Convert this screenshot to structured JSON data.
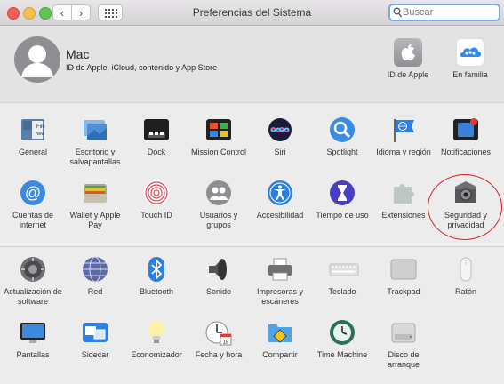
{
  "window": {
    "title": "Preferencias del Sistema"
  },
  "search": {
    "placeholder": "Buscar"
  },
  "account": {
    "name": "Mac",
    "subtitle": "ID de Apple, iCloud, contenido y App Store"
  },
  "account_items": [
    {
      "label": "ID de Apple",
      "icon": "apple-id-icon"
    },
    {
      "label": "En familia",
      "icon": "family-sharing-icon"
    }
  ],
  "row1": [
    {
      "label": "General",
      "icon": "general-icon"
    },
    {
      "label": "Escritorio y salvapantallas",
      "icon": "desktop-screensaver-icon"
    },
    {
      "label": "Dock",
      "icon": "dock-icon"
    },
    {
      "label": "Mission Control",
      "icon": "mission-control-icon"
    },
    {
      "label": "Siri",
      "icon": "siri-icon"
    },
    {
      "label": "Spotlight",
      "icon": "spotlight-icon"
    },
    {
      "label": "Idioma y región",
      "icon": "language-region-icon"
    },
    {
      "label": "Notificaciones",
      "icon": "notifications-icon"
    }
  ],
  "row2": [
    {
      "label": "Cuentas de internet",
      "icon": "internet-accounts-icon"
    },
    {
      "label": "Wallet y Apple Pay",
      "icon": "wallet-icon"
    },
    {
      "label": "Touch ID",
      "icon": "touch-id-icon"
    },
    {
      "label": "Usuarios y grupos",
      "icon": "users-groups-icon"
    },
    {
      "label": "Accesibilidad",
      "icon": "accessibility-icon"
    },
    {
      "label": "Tiempo de uso",
      "icon": "screen-time-icon"
    },
    {
      "label": "Extensiones",
      "icon": "extensions-icon"
    },
    {
      "label": "Seguridad y privacidad",
      "icon": "security-privacy-icon"
    }
  ],
  "row3": [
    {
      "label": "Actualización de software",
      "icon": "software-update-icon"
    },
    {
      "label": "Red",
      "icon": "network-icon"
    },
    {
      "label": "Bluetooth",
      "icon": "bluetooth-icon"
    },
    {
      "label": "Sonido",
      "icon": "sound-icon"
    },
    {
      "label": "Impresoras y escáneres",
      "icon": "printers-scanners-icon"
    },
    {
      "label": "Teclado",
      "icon": "keyboard-icon"
    },
    {
      "label": "Trackpad",
      "icon": "trackpad-icon"
    },
    {
      "label": "Ratón",
      "icon": "mouse-icon"
    }
  ],
  "row4": [
    {
      "label": "Pantallas",
      "icon": "displays-icon"
    },
    {
      "label": "Sidecar",
      "icon": "sidecar-icon"
    },
    {
      "label": "Economizador",
      "icon": "energy-saver-icon"
    },
    {
      "label": "Fecha y hora",
      "icon": "date-time-icon"
    },
    {
      "label": "Compartir",
      "icon": "sharing-icon"
    },
    {
      "label": "Time Machine",
      "icon": "time-machine-icon"
    },
    {
      "label": "Disco de arranque",
      "icon": "startup-disk-icon"
    }
  ],
  "colors": {
    "highlight_circle": "#d62027",
    "search_focus": "#7aa7e6"
  }
}
